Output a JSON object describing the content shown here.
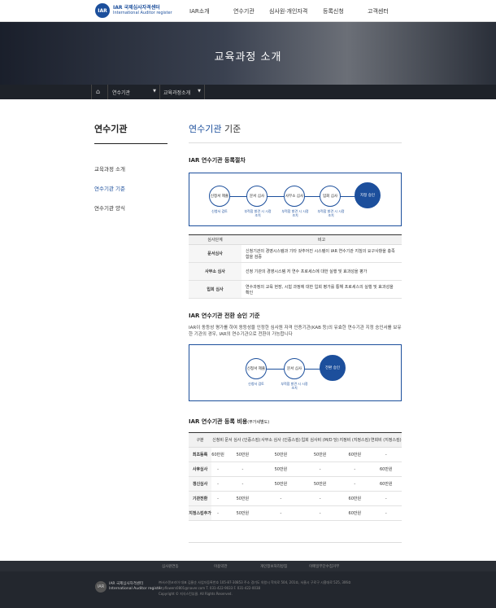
{
  "header": {
    "logo_mark": "IAR",
    "logo_line1": "IAR 국제심사자격센터",
    "logo_line2": "International Auditor register",
    "nav": [
      "IAR소개",
      "연수기관",
      "심사원·개인자격",
      "등록신청",
      "고객센터"
    ]
  },
  "hero": {
    "title": "교육과정 소개"
  },
  "breadcrumb": {
    "level1": "연수기관",
    "level2": "교육과정소개"
  },
  "lnb": {
    "title": "연수기관",
    "items": [
      "교육과정 소개",
      "연수기관 기준",
      "연수기관 양식"
    ]
  },
  "content": {
    "title_accent": "연수기관",
    "title_rest": " 기준",
    "section1": "IAR 연수기관 등록절차",
    "flow1": {
      "nodes": [
        "신청서 제출",
        "문서 심사",
        "사무소 심사",
        "입회 심사",
        "지정 승인"
      ],
      "notes": [
        "신청서 검토",
        "부적합 발견 시 시정 조치",
        "부적합 발견 시 시정 조치",
        "부적합 발견 시 시정 조치"
      ]
    },
    "table1": {
      "headers": [
        "심사단계",
        "비고"
      ],
      "rows": [
        [
          "문서심사",
          "신청기관의 경영시스템과 기타 갖추어진 시스템이 IAR 연수기관 지침의 요구사항을 충족함을 검증"
        ],
        [
          "사무소 심사",
          "선정 기관의 경영시스템 저 연수 프로세스에 대한 실행 및 효과성을 평가"
        ],
        [
          "입회 심사",
          "연수과정의 교육 현장, 시험 과정에 대한 입회 평가를 통해 프로세스의 실행 및 효과성을 확인"
        ]
      ]
    },
    "section2": "IAR 연수기관 전환 승인 기준",
    "section2_desc": "IAR이 동등성 평가를 하여 동등성을 인정한 심사원 자격 인증기관(KAB 등)의 유효한 연수기관 지정 승인서를 보유한 기관의 경우, IAR의 연수기관으로 전환이 가능합니다",
    "flow2": {
      "nodes": [
        "신청서 제출",
        "문서 심사",
        "전환 승인"
      ],
      "notes": [
        "신청서 검토",
        "부적합 발견 시 시정 조치"
      ]
    },
    "section3": "IAR 연수기관 등록 비용",
    "section3_sub": "(부가세별도)",
    "table2": {
      "headers": [
        "구분",
        "신청비",
        "문서 심사 (인증스킴)",
        "사무소 심사 (인증스킴)",
        "입회 심사비 (M/D 당)",
        "지정비 (지정스킴)",
        "연회비 (지정스킴)"
      ],
      "rows": [
        [
          "최초등록",
          "60만원",
          "50만원",
          "50만원",
          "50만원",
          "60만원",
          "-"
        ],
        [
          "사후심사",
          "-",
          "-",
          "50만원",
          "-",
          "-",
          "60만원"
        ],
        [
          "갱신심사",
          "-",
          "-",
          "50만원",
          "50만원",
          "-",
          "60만원"
        ],
        [
          "기관전환",
          "-",
          "50만원",
          "-",
          "-",
          "60만원",
          "-"
        ],
        [
          "지정스킴추가",
          "-",
          "50만원",
          "-",
          "-",
          "60만원",
          "-"
        ]
      ]
    }
  },
  "footer": {
    "links": [
      "심사원연동",
      "이용약관",
      "개인정보처리방침",
      "이메일무단수집거부"
    ],
    "logo_line1": "IAR 국제심사자격센터",
    "logo_line2": "International Auditor register",
    "info1": "㈜서스탠코리아   대표 김율순   사업자등록번호 105-87-30853   주소 경기도 의왕시 학의로 504, 201호, 서울시 구로구 시흥대로 525, 306호",
    "info2": "E. pflowers0801@naver.com   T. 031-422-9033   F. 031-422-0038",
    "copyright": "Copyright © 지식스킨뷰클. All Rights Reserved."
  }
}
